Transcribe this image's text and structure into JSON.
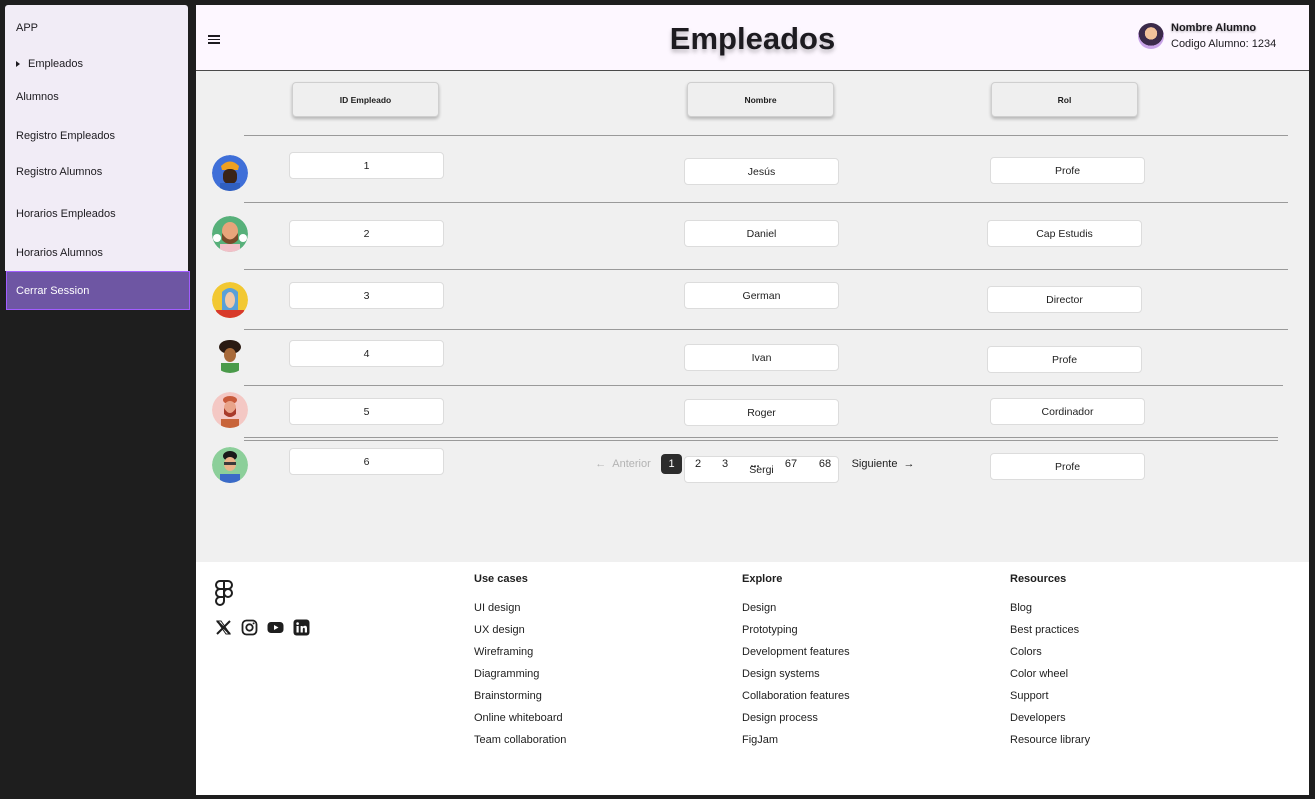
{
  "sidebar": {
    "app_label": "APP",
    "items": [
      {
        "label": "Empleados"
      },
      {
        "label": "Alumnos"
      },
      {
        "label": "Registro Empleados"
      },
      {
        "label": "Registro Alumnos"
      },
      {
        "label": "Horarios Empleados"
      },
      {
        "label": "Horarios Alumnos"
      }
    ],
    "logout_label": "Cerrar Session"
  },
  "header": {
    "title": "Empleados",
    "user_name": "Nombre Alumno",
    "user_code": "Codigo Alumno: 1234"
  },
  "table": {
    "columns": [
      "ID Empleado",
      "Nombre",
      "Rol"
    ],
    "rows": [
      {
        "id": "1",
        "name": "Jesús",
        "role": "Profe",
        "avatar": "avatar-icon"
      },
      {
        "id": "2",
        "name": "Daniel",
        "role": "Cap Estudis",
        "avatar": "avatar-icon"
      },
      {
        "id": "3",
        "name": "German",
        "role": "Director",
        "avatar": "avatar-icon"
      },
      {
        "id": "4",
        "name": "Ivan",
        "role": "Profe",
        "avatar": "avatar-icon"
      },
      {
        "id": "5",
        "name": "Roger",
        "role": "Cordinador",
        "avatar": "avatar-icon"
      },
      {
        "id": "6",
        "name": "Sergi",
        "role": "Profe",
        "avatar": "avatar-icon"
      }
    ]
  },
  "pagination": {
    "prev": "Anterior",
    "pages": [
      "1",
      "2",
      "3",
      "...",
      "67",
      "68"
    ],
    "current": "1",
    "next": "Siguiente"
  },
  "footer": {
    "social_icons": [
      "figma-logo-icon",
      "x-icon",
      "instagram-icon",
      "youtube-icon",
      "linkedin-icon"
    ],
    "columns": [
      {
        "title": "Use cases",
        "links": [
          "UI design",
          "UX design",
          "Wireframing",
          "Diagramming",
          "Brainstorming",
          "Online whiteboard",
          "Team collaboration"
        ]
      },
      {
        "title": "Explore",
        "links": [
          "Design",
          "Prototyping",
          "Development features",
          "Design systems",
          "Collaboration features",
          "Design process",
          "FigJam"
        ]
      },
      {
        "title": "Resources",
        "links": [
          "Blog",
          "Best practices",
          "Colors",
          "Color wheel",
          "Support",
          "Developers",
          "Resource library"
        ]
      }
    ]
  },
  "colors": {
    "sidebar_bg": "#f1ecf6",
    "logout_bg": "#6e56a3",
    "header_bg": "#fdf7ff",
    "content_bg": "#f0f0f0"
  }
}
